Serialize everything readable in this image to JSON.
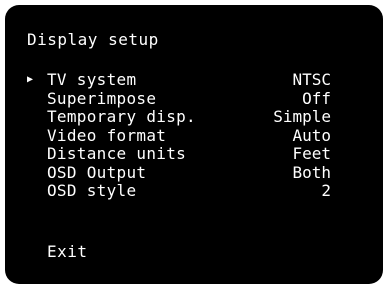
{
  "screen": {
    "title": "Display setup",
    "cursor_symbol": "▶",
    "selected_index": 0,
    "items": [
      {
        "label": "TV system",
        "value": "NTSC"
      },
      {
        "label": "Superimpose",
        "value": "Off"
      },
      {
        "label": "Temporary disp.",
        "value": "Simple"
      },
      {
        "label": "Video format",
        "value": "Auto"
      },
      {
        "label": "Distance units",
        "value": "Feet"
      },
      {
        "label": "OSD Output",
        "value": "Both"
      },
      {
        "label": "OSD style",
        "value": "2"
      }
    ],
    "exit_label": "Exit"
  },
  "colors": {
    "screen_background": "#000000",
    "text": "#ffffff"
  }
}
